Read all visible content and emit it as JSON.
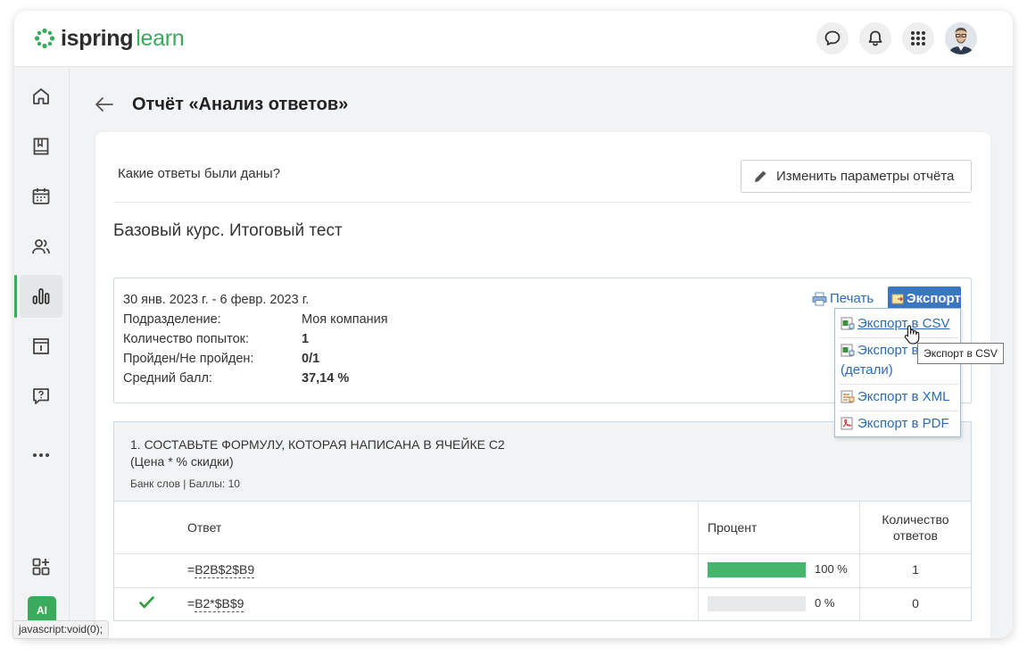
{
  "app": {
    "logo_brand": "ispring",
    "logo_product": "learn",
    "accent_color": "#3aaa5c",
    "link_color": "#2a6bb3"
  },
  "topbar": {
    "icons": [
      "chat-icon",
      "bell-icon",
      "apps-grid-icon"
    ],
    "avatar": "user-avatar"
  },
  "sidebar": {
    "items": [
      "home-icon",
      "book-icon",
      "calendar-icon",
      "users-icon",
      "reports-icon",
      "info-icon",
      "help-icon",
      "more-icon"
    ],
    "active": "reports-icon",
    "bottom": [
      "add-widget-icon"
    ],
    "ai_label": "AI"
  },
  "page": {
    "title": "Отчёт «Анализ ответов»"
  },
  "report": {
    "question_label": "Какие ответы были даны?",
    "change_button": "Изменить параметры отчёта",
    "course_title": "Базовый курс. Итоговый тест",
    "date_range": "30 янв. 2023 г. - 6 февр. 2023 г.",
    "fields": [
      {
        "label": "Подразделение:",
        "value": "Моя компания"
      },
      {
        "label": "Количество попыток:",
        "value": "1"
      },
      {
        "label": "Пройден/Не пройден:",
        "value": "0/1"
      },
      {
        "label": "Средний балл:",
        "value": "37,14 %"
      }
    ],
    "print_label": "Печать",
    "export_label": "Экспорт"
  },
  "export_menu": {
    "items": [
      {
        "line1": "Экспорт в CSV",
        "line2": ""
      },
      {
        "line1": "Экспорт в",
        "line2": "(детали)"
      },
      {
        "line1": "Экспорт в XML",
        "line2": ""
      },
      {
        "line1": "Экспорт в PDF",
        "line2": ""
      }
    ],
    "tooltip": "Экспорт в CSV"
  },
  "question": {
    "title_line1": "1. СОСТАВЬТЕ ФОРМУЛУ, КОТОРАЯ НАПИСАНА В ЯЧЕЙКЕ С2",
    "title_line2": "(Цена * % скидки)",
    "meta": "Банк слов | Баллы: 10",
    "columns": {
      "answer": "Ответ",
      "percent": "Процент",
      "count_line1": "Количество",
      "count_line2": "ответов"
    },
    "rows": [
      {
        "correct": false,
        "prefix": "=",
        "answer": "B2B$2$B9",
        "percent": 100,
        "percent_label": "100 %",
        "count": "1"
      },
      {
        "correct": true,
        "prefix": "=",
        "answer": "B2*$B$9",
        "percent": 0,
        "percent_label": "0 %",
        "count": "0"
      }
    ]
  },
  "statusbar": {
    "text": "javascript:void(0);"
  }
}
